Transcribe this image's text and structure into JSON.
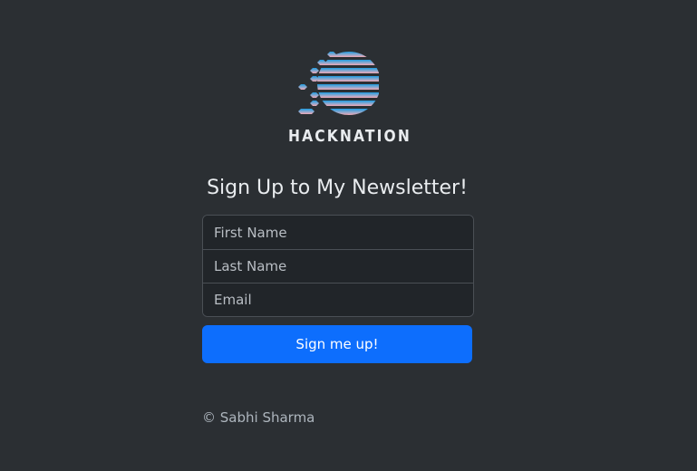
{
  "brand": {
    "name": "HACKNATION",
    "logo_icon": "hex-striped-circle-logo",
    "gradient_top": "#1f9be0",
    "gradient_bottom": "#f0a8b4"
  },
  "form": {
    "heading": "Sign Up to My Newsletter!",
    "first_name_placeholder": "First Name",
    "last_name_placeholder": "Last Name",
    "email_placeholder": "Email",
    "submit_label": "Sign me up!",
    "submit_color": "#0d6efd"
  },
  "footer": {
    "copyright": "© Sabhi Sharma"
  }
}
